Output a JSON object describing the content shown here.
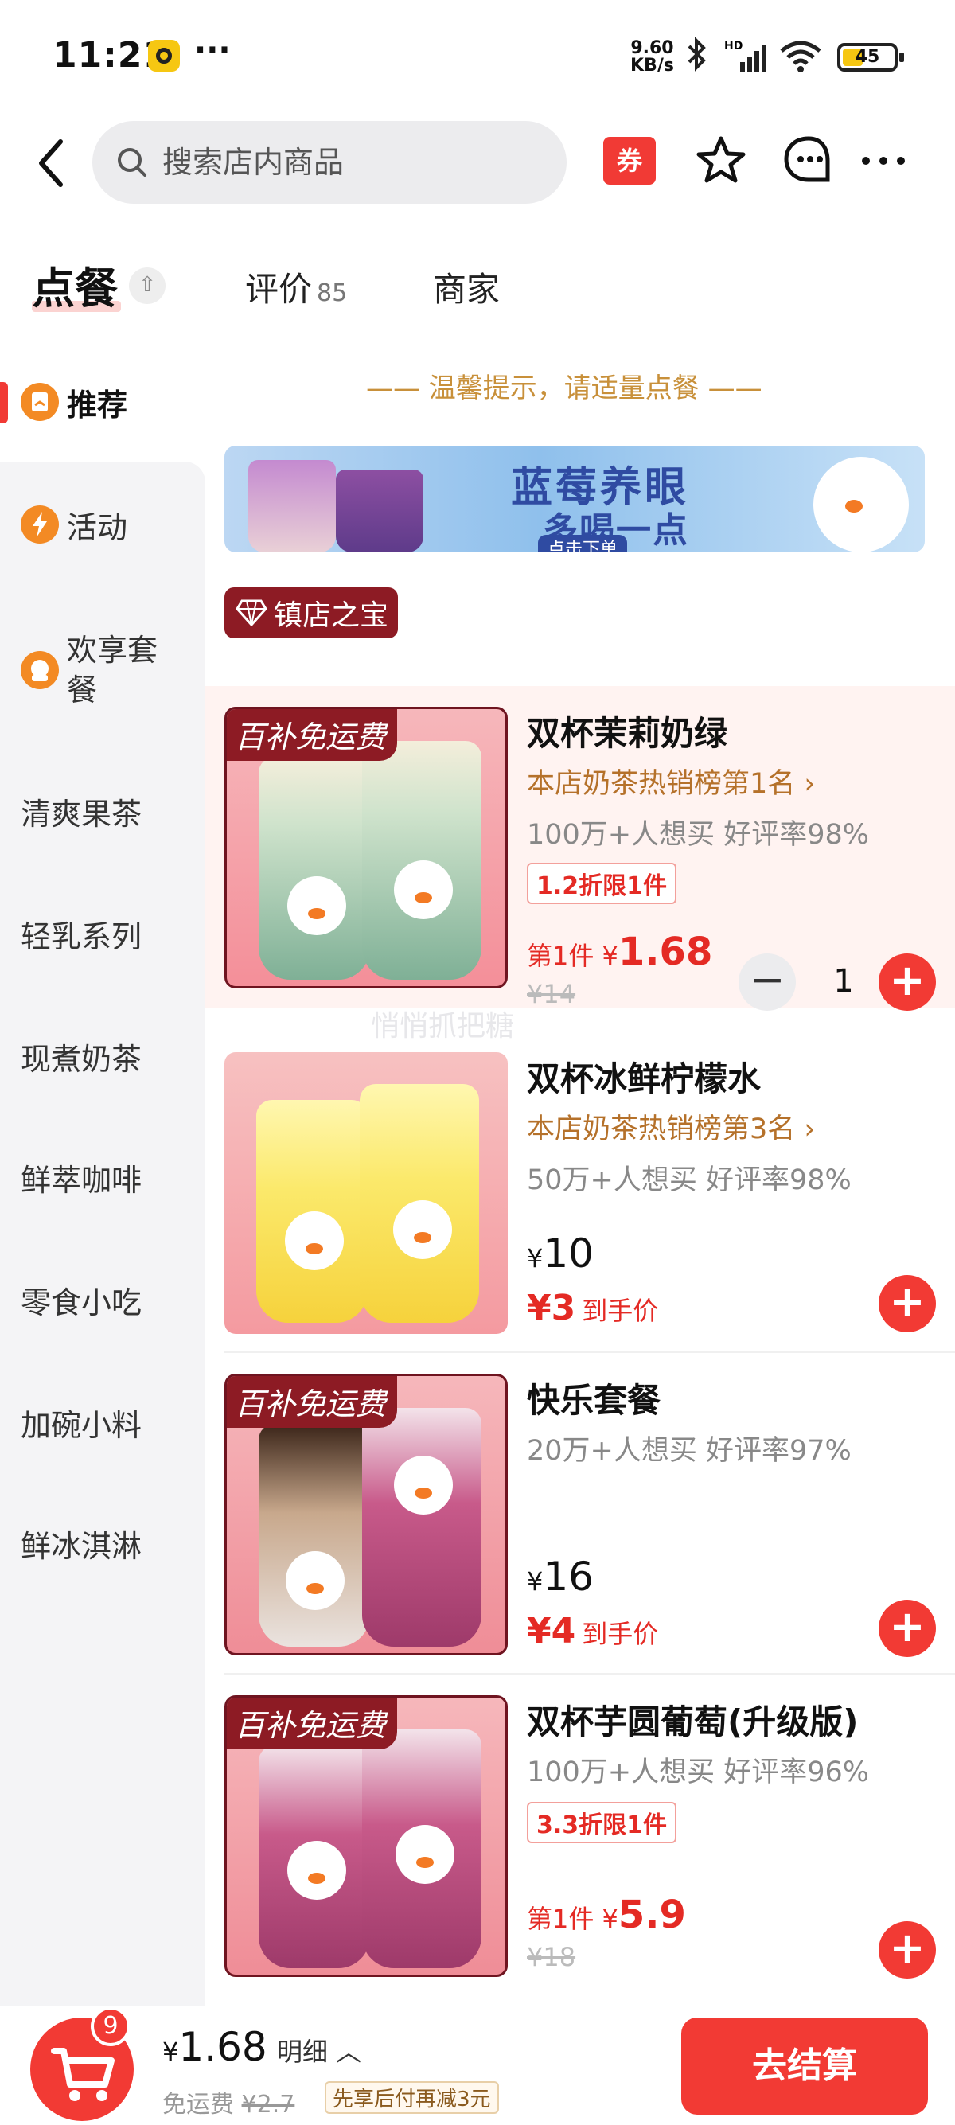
{
  "status": {
    "time": "11:21",
    "net_speed_value": "9.60",
    "net_speed_unit": "KB/s",
    "battery": "45",
    "battery_level_percent": 45,
    "overflow": "···"
  },
  "header": {
    "search_placeholder": "搜索店内商品",
    "coupon_label": "券",
    "icons": [
      "back-icon",
      "search-icon",
      "coupon-icon",
      "star-icon",
      "chat-icon",
      "more-icon"
    ]
  },
  "tabs": {
    "order": "点餐",
    "collapse": "⇧",
    "review": "评价",
    "review_count": "85",
    "merchant": "商家"
  },
  "sidebar": {
    "items": [
      {
        "label": "推荐",
        "icon": "recommend-icon"
      },
      {
        "label": "活动",
        "icon": "activity-icon"
      },
      {
        "label": "欢享套餐",
        "icon": "combo-icon"
      },
      {
        "label": "清爽果茶"
      },
      {
        "label": "轻乳系列"
      },
      {
        "label": "现煮奶茶"
      },
      {
        "label": "鲜萃咖啡"
      },
      {
        "label": "零食小吃"
      },
      {
        "label": "加碗小料"
      },
      {
        "label": "鲜冰淇淋"
      }
    ]
  },
  "content": {
    "tip": "—— 温馨提示，请适量点餐 ——",
    "banner_title": "蓝莓养眼",
    "banner_subtitle": "多喝一点",
    "banner_cta": "点击下单",
    "section_badge": "镇店之宝",
    "watermark": "悄悄抓把糖",
    "free_shipping_badge": "百补免运费",
    "products": [
      {
        "name": "双杯茉莉奶绿",
        "rank": "本店奶茶热销榜第1名 ›",
        "stats": "100万+人想买  好评率98%",
        "limit": "1.2折限1件",
        "first_prefix": "第1件 ¥",
        "first_price": "1.68",
        "orig_price": "¥14",
        "qty": "1",
        "plus": "+",
        "minus": "−"
      },
      {
        "name": "双杯冰鲜柠檬水",
        "rank": "本店奶茶热销榜第3名 ›",
        "stats": "50万+人想买  好评率98%",
        "price_symbol": "¥",
        "price": "10",
        "hand_price": "¥3",
        "hand_label": "到手价",
        "plus": "+"
      },
      {
        "name": "快乐套餐",
        "stats": "20万+人想买  好评率97%",
        "price_symbol": "¥",
        "price": "16",
        "hand_price": "¥4",
        "hand_label": "到手价",
        "plus": "+"
      },
      {
        "name": "双杯芋圆葡萄(升级版)",
        "stats": "100万+人想买  好评率96%",
        "limit": "3.3折限1件",
        "first_prefix": "第1件 ¥",
        "first_price": "5.9",
        "orig_price": "¥18",
        "plus": "+"
      }
    ]
  },
  "bottom": {
    "cart_count": "9",
    "total_symbol": "¥",
    "total": "1.68",
    "detail": "明细 ︿",
    "free_ship_label": "免运费",
    "free_ship_orig": "¥2.7",
    "paylater": "先享后付再减3元",
    "checkout": "去结算"
  },
  "colors": {
    "accent": "#f23a34",
    "rank_gold": "#b5712a",
    "badge_dark_red": "#8d1b24",
    "tip_gold": "#c8903a"
  }
}
